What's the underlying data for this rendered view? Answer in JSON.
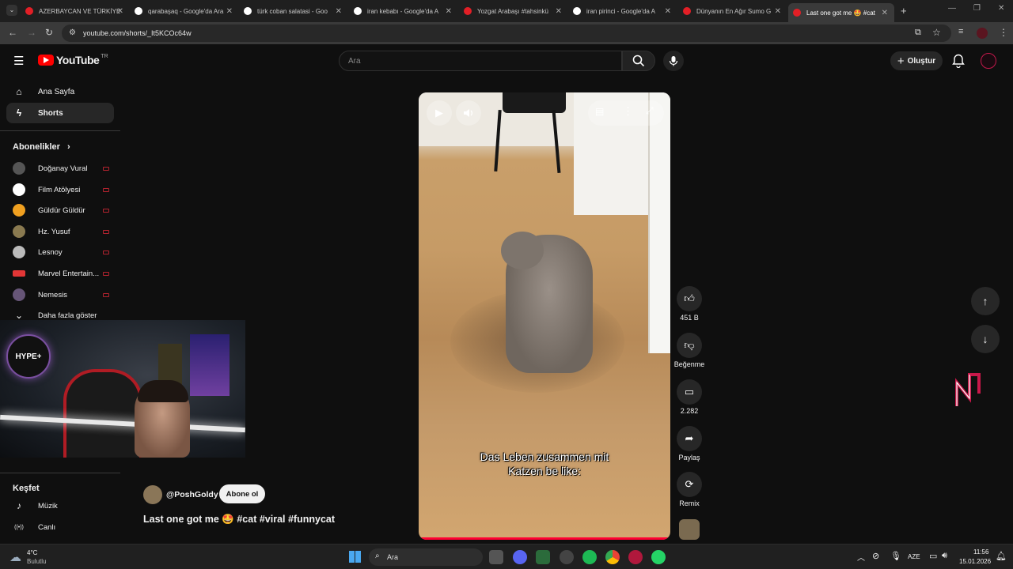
{
  "tabs": [
    {
      "title": "AZERBAYCAN VE TÜRKİYE",
      "fav": "#e21f26"
    },
    {
      "title": "qarabaşaq - Google'da Ara",
      "fav": "#ffffff"
    },
    {
      "title": "türk coban salatasi - Goo",
      "fav": "#ffffff"
    },
    {
      "title": "iran kebabı - Google'da A",
      "fav": "#ffffff"
    },
    {
      "title": "Yozgat Arabaşı #tahsinkü",
      "fav": "#e21f26"
    },
    {
      "title": "iran pirinci - Google'da A",
      "fav": "#ffffff"
    },
    {
      "title": "Dünyanın En Ağır Sumo G",
      "fav": "#e21f26"
    },
    {
      "title": "Last one got me 🤩 #cat",
      "fav": "#e21f26"
    }
  ],
  "address": {
    "url": "youtube.com/shorts/_It5KCOc64w"
  },
  "youtube": {
    "logo_text": "YouTube",
    "region": "TR",
    "search_placeholder": "Ara",
    "create_label": "Oluştur"
  },
  "sidebar": {
    "home": "Ana Sayfa",
    "shorts": "Shorts",
    "subs_heading": "Abonelikler",
    "subs": [
      {
        "name": "Doğanay Vural",
        "color": "#555"
      },
      {
        "name": "Film Atölyesi",
        "color": "#fff"
      },
      {
        "name": "Güldür Güldür",
        "color": "#f0a020"
      },
      {
        "name": "Hz. Yusuf",
        "color": "#8a7a50"
      },
      {
        "name": "Lesnoy",
        "color": "#bbb"
      },
      {
        "name": "Marvel Entertain...",
        "color": "#e23636"
      },
      {
        "name": "Nemesis",
        "color": "#665577"
      }
    ],
    "show_more": "Daha fazla göster",
    "explore_heading": "Keşfet",
    "explore": [
      {
        "label": "Müzik",
        "icon": "♪"
      },
      {
        "label": "Canlı",
        "icon": "((•))"
      }
    ]
  },
  "short": {
    "caption_line1": "Das Leben zusammen mit",
    "caption_line2": "Katzen be like:",
    "channel": "@PoshGoldy",
    "subscribe": "Abone ol",
    "title": "Last one got me 🤩 #cat #viral #funnycat",
    "likes": "451 B",
    "dislike_label": "Beğenme",
    "comments": "2.282",
    "share_label": "Paylaş",
    "remix_label": "Remix"
  },
  "overlay": {
    "hype": "HYPE+"
  },
  "taskbar": {
    "temp": "4°C",
    "weather": "Bulutlu",
    "search": "Ara",
    "lang": "AZE",
    "time": "11:56",
    "date": "15.01.2026"
  }
}
